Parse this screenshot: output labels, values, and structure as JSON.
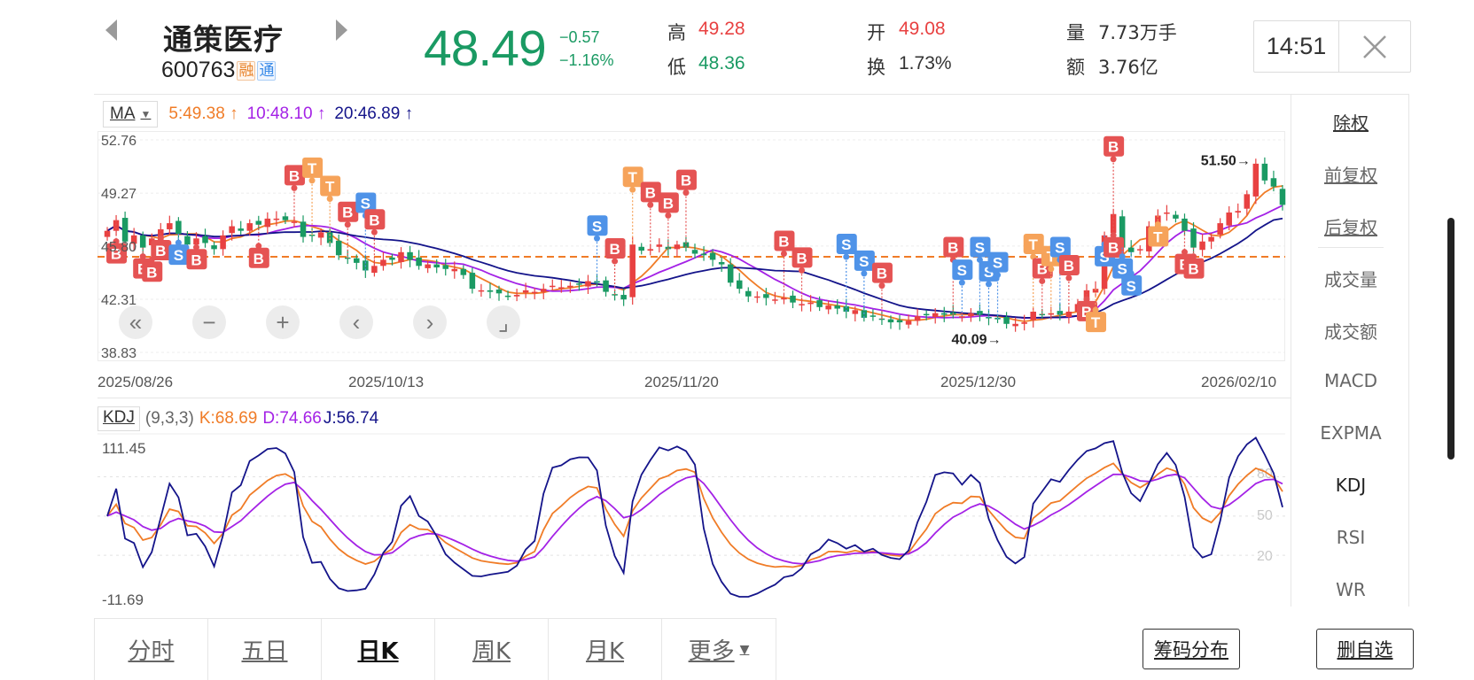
{
  "header": {
    "name": "通策医疗",
    "code": "600763",
    "tag_margin": "融",
    "tag_connect": "通",
    "price": "48.49",
    "change": "−0.57",
    "change_pct": "−1.16%",
    "high_label": "高",
    "high": "49.28",
    "low_label": "低",
    "low": "48.36",
    "open_label": "开",
    "open": "49.08",
    "turnover_label": "换",
    "turnover": "1.73%",
    "volume_label": "量",
    "volume": "7.73万手",
    "amount_label": "额",
    "amount": "3.76亿",
    "time": "14:51"
  },
  "colors": {
    "up": "#e84141",
    "down": "#1a9a63",
    "ma5": "#f07c27",
    "ma10": "#a422e6",
    "ma20": "#14148a",
    "ref_line": "#f07c27",
    "buy_tag": "#e55353",
    "sell_tag": "#4f93e8",
    "t_tag": "#f6a35a"
  },
  "main_chart": {
    "indicator": "MA",
    "ma5": "5:49.38",
    "ma10": "10:48.10",
    "ma20": "20:46.89",
    "arrow": "↑",
    "y_ticks": [
      "52.76",
      "49.27",
      "45.80",
      "42.31",
      "38.83"
    ],
    "x_ticks": [
      "2025/08/26",
      "2025/10/13",
      "2025/11/20",
      "2025/12/30",
      "2026/02/10"
    ],
    "max_label": "51.50→",
    "min_label": "40.09→"
  },
  "chart_data": {
    "type": "candlestick",
    "y_range": [
      38.83,
      52.76
    ],
    "reference_line": 45.1,
    "close": [
      46.8,
      47.5,
      46.1,
      46.5,
      45.7,
      46.3,
      46.9,
      47.3,
      46.6,
      45.9,
      46.3,
      46.0,
      45.6,
      46.5,
      47.1,
      46.8,
      47.3,
      47.2,
      47.6,
      47.6,
      47.5,
      47.4,
      46.4,
      46.5,
      46.7,
      46.0,
      45.2,
      45.0,
      44.7,
      44.2,
      44.5,
      44.9,
      44.9,
      45.4,
      44.9,
      44.5,
      44.6,
      44.4,
      44.3,
      44.3,
      43.9,
      43.0,
      42.9,
      42.8,
      42.7,
      42.5,
      42.6,
      42.9,
      42.8,
      43.0,
      43.2,
      43.1,
      43.2,
      43.3,
      43.5,
      43.4,
      42.8,
      42.6,
      42.3,
      45.9,
      45.5,
      45.6,
      45.9,
      45.6,
      45.9,
      45.7,
      45.3,
      45.2,
      44.9,
      44.6,
      43.4,
      43.0,
      42.5,
      42.5,
      42.4,
      42.3,
      42.4,
      42.1,
      42.0,
      42.1,
      41.8,
      41.9,
      41.7,
      41.5,
      41.6,
      41.1,
      41.2,
      41.0,
      40.8,
      40.8,
      40.9,
      41.2,
      41.3,
      41.4,
      41.3,
      41.3,
      41.2,
      41.4,
      41.3,
      41.1,
      41.0,
      40.7,
      40.7,
      40.8,
      41.5,
      41.3,
      41.4,
      41.3,
      41.5,
      42.0,
      42.9,
      43.0,
      46.5,
      47.9,
      45.7,
      45.4,
      45.6,
      47.1,
      47.8,
      48.0,
      47.6,
      46.8,
      45.7,
      46.1,
      46.4,
      47.3,
      48.0,
      48.1,
      49.2,
      51.2,
      50.1,
      49.7,
      48.5
    ],
    "ma5_last": 49.38,
    "ma10_last": 48.1,
    "ma20_last": 46.89,
    "high_annotation": 51.5,
    "low_annotation": 40.09,
    "kdj": {
      "params": "(9,3,3)",
      "K": 68.69,
      "D": 74.66,
      "J": 56.74,
      "y_range": [
        -11.69,
        111.45
      ],
      "guide_levels": [
        80,
        50,
        20
      ]
    }
  },
  "kdj_panel": {
    "name": "KDJ",
    "params": "(9,3,3)",
    "k": "K:68.69",
    "d": "D:74.66",
    "j": "J:56.74",
    "y_top": "111.45",
    "y_bottom": "-11.69",
    "guide_80": "80",
    "guide_50": "50",
    "guide_20": "20"
  },
  "right_panel": {
    "items": [
      "除权",
      "前复权",
      "后复权",
      "成交量",
      "成交额",
      "MACD",
      "EXPMA",
      "KDJ",
      "RSI",
      "WR"
    ]
  },
  "tabs": [
    "分时",
    "五日",
    "日K",
    "周K",
    "月K",
    "更多"
  ],
  "buttons": {
    "chips": "筹码分布",
    "remove_watch": "删自选"
  }
}
